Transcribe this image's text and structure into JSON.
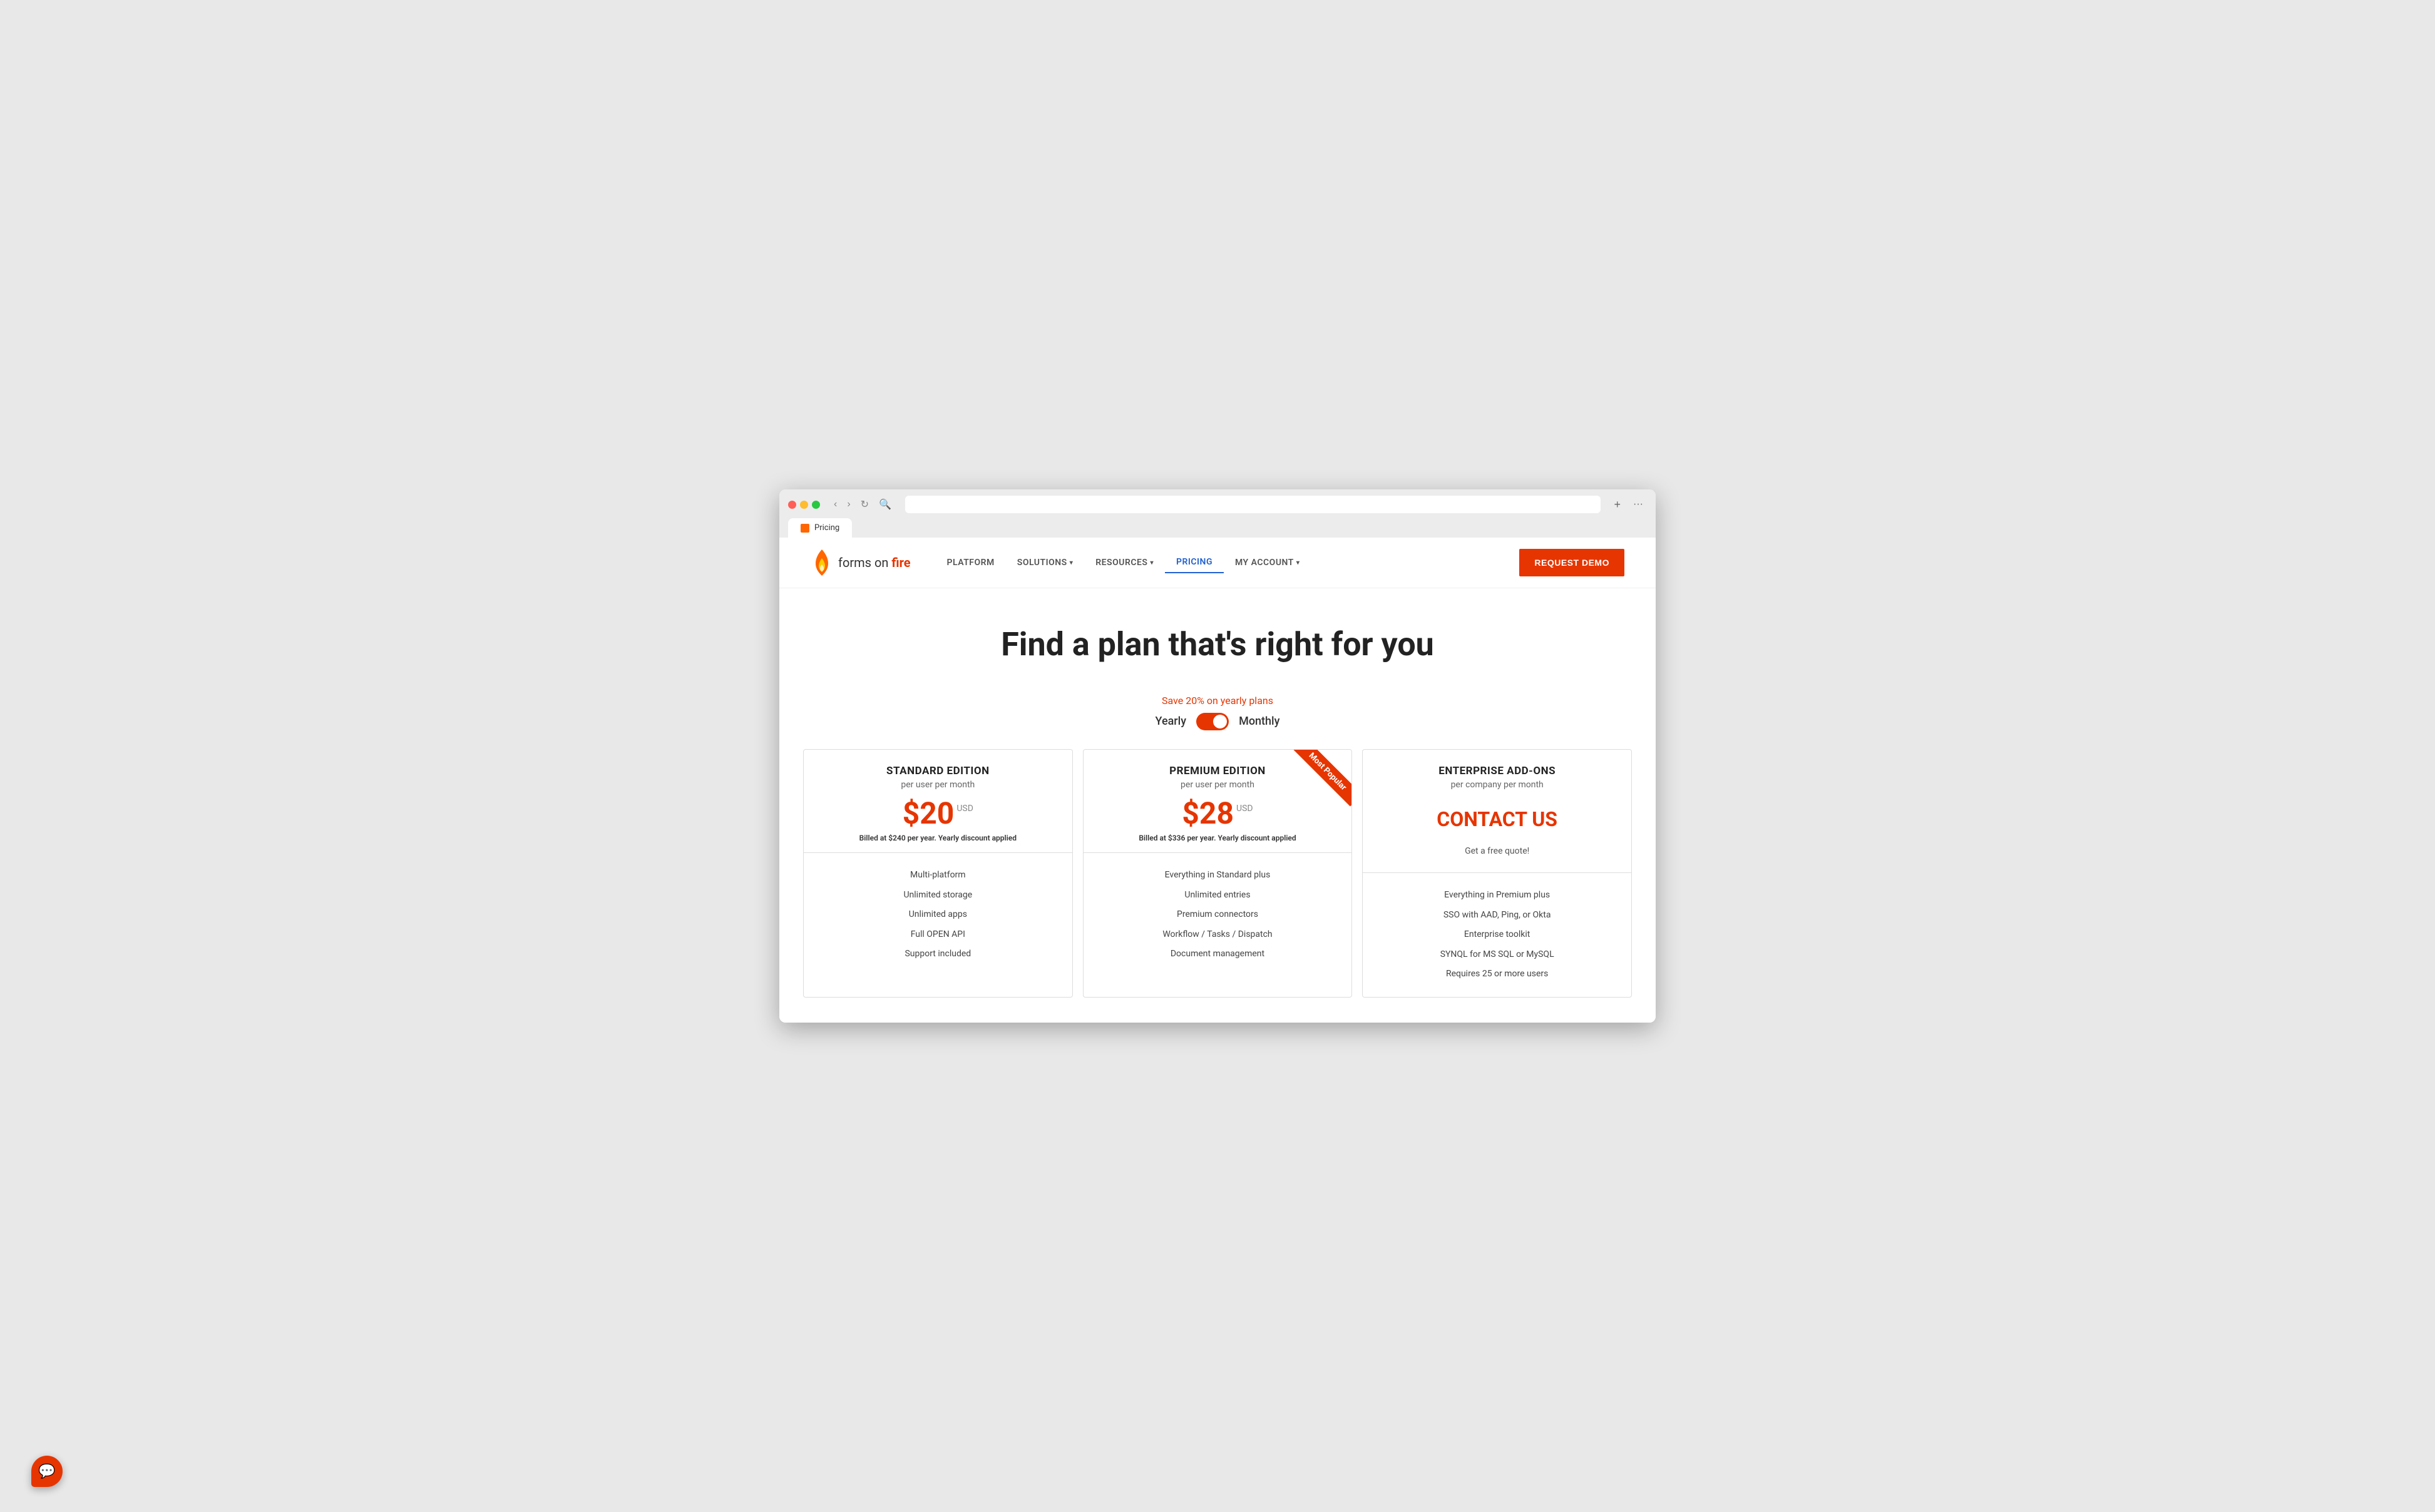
{
  "browser": {
    "tab_title": "Pricing",
    "new_tab_symbol": "+",
    "more_symbol": "···"
  },
  "navbar": {
    "logo_text": "forms on fire",
    "logo_brand": "fire",
    "nav_items": [
      {
        "label": "PLATFORM",
        "active": false,
        "has_dropdown": false
      },
      {
        "label": "SOLUTIONS",
        "active": false,
        "has_dropdown": true
      },
      {
        "label": "RESOURCES",
        "active": false,
        "has_dropdown": true
      },
      {
        "label": "PRICING",
        "active": true,
        "has_dropdown": false
      },
      {
        "label": "MY ACCOUNT",
        "active": false,
        "has_dropdown": true
      }
    ],
    "cta_button": "REQUEST DEMO"
  },
  "hero": {
    "title": "Find a plan that's right for you"
  },
  "billing": {
    "save_text": "Save 20% on yearly plans",
    "yearly_label": "Yearly",
    "monthly_label": "Monthly",
    "toggle_state": "monthly"
  },
  "pricing": {
    "cards": [
      {
        "id": "standard",
        "title": "STANDARD EDITION",
        "subtitle": "per user per month",
        "price": "$20",
        "price_usd": "USD",
        "billing_note": "Billed at $240 per year. Yearly discount applied",
        "contact": null,
        "free_quote": null,
        "features": [
          "Multi-platform",
          "Unlimited storage",
          "Unlimited apps",
          "Full OPEN API",
          "Support included"
        ],
        "featured": false
      },
      {
        "id": "premium",
        "title": "PREMIUM EDITION",
        "subtitle": "per user per month",
        "price": "$28",
        "price_usd": "USD",
        "billing_note": "Billed at $336 per year. Yearly discount applied",
        "contact": null,
        "free_quote": null,
        "features": [
          "Everything in Standard plus",
          "Unlimited entries",
          "Premium connectors",
          "Workflow / Tasks / Dispatch",
          "Document management"
        ],
        "featured": true,
        "ribbon_text": "Most Popular"
      },
      {
        "id": "enterprise",
        "title": "ENTERPRISE ADD-ONS",
        "subtitle": "per company per month",
        "price": null,
        "price_usd": null,
        "billing_note": null,
        "contact": "CONTACT US",
        "free_quote": "Get a free quote!",
        "features": [
          "Everything in Premium plus",
          "SSO with AAD, Ping, or Okta",
          "Enterprise toolkit",
          "SYNQL for MS SQL or MySQL",
          "Requires 25 or more users"
        ],
        "featured": false
      }
    ]
  },
  "chat": {
    "icon": "💬"
  }
}
